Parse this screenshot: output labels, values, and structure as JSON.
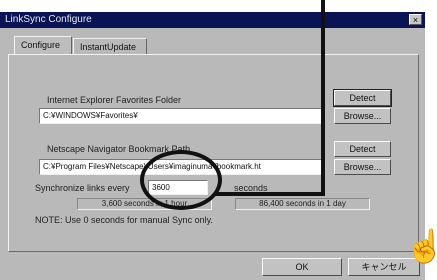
{
  "window": {
    "title": "LinkSync Configure",
    "close_glyph": "×"
  },
  "tabs": [
    {
      "label": "Configure",
      "active": true
    },
    {
      "label": "InstantUpdate",
      "active": false
    }
  ],
  "ie": {
    "label": "Internet Explorer Favorites Folder",
    "value": "C:¥WINDOWS¥Favorites¥",
    "detect_label": "Detect",
    "browse_label": "Browse..."
  },
  "netscape": {
    "label": "Netscape Navigator Bookmark Path",
    "value": "C:¥Program Files¥Netscape¥Users¥imaginuma¥bookmark.ht",
    "detect_label": "Detect",
    "browse_label": "Browse..."
  },
  "sync": {
    "label_prefix": "Synchronize links every",
    "value": "3600",
    "unit": "seconds",
    "hint_hour": "3,600 seconds in 1 hour",
    "hint_day": "86,400 seconds in 1 day",
    "note": "NOTE: Use 0 seconds for manual Sync only."
  },
  "footer": {
    "ok_label": "OK",
    "cancel_label": "キャンセル"
  },
  "annotation": {
    "pointer_icon": "pointing-hand-icon",
    "pointer_glyph": "☝"
  },
  "colors": {
    "titlebar": "#0a1454",
    "window_bg": "#b9b9b9"
  }
}
